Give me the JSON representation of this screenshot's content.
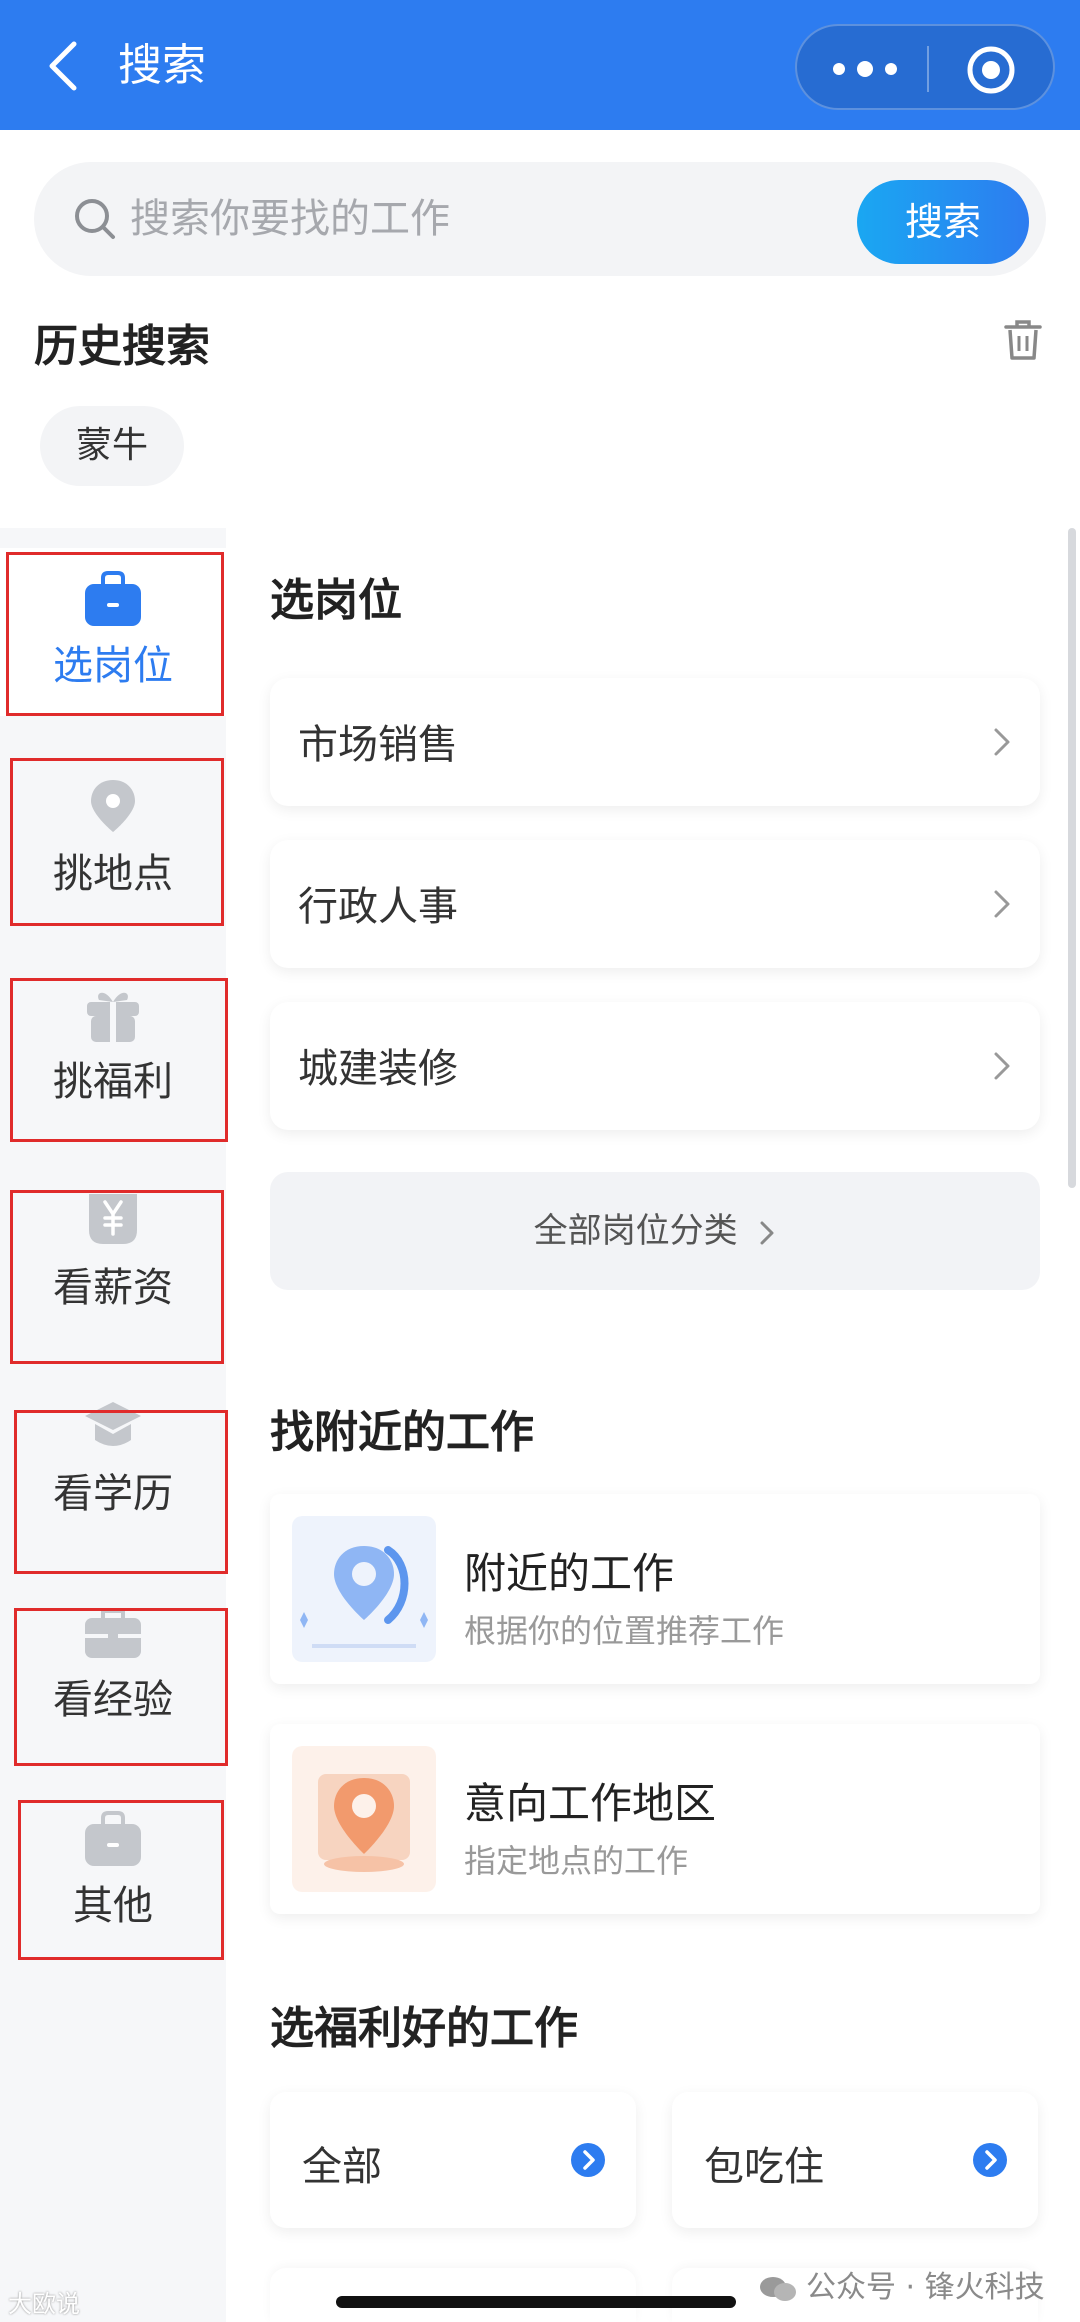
{
  "navbar": {
    "title": "搜索"
  },
  "search": {
    "placeholder": "搜索你要找的工作",
    "button_label": "搜索"
  },
  "history": {
    "title": "历史搜索",
    "items": [
      "蒙牛"
    ]
  },
  "sidebar": {
    "items": [
      {
        "label": "选岗位",
        "icon": "briefcase-icon",
        "active": true
      },
      {
        "label": "挑地点",
        "icon": "location-pin-icon"
      },
      {
        "label": "挑福利",
        "icon": "gift-icon"
      },
      {
        "label": "看薪资",
        "icon": "yuan-icon"
      },
      {
        "label": "看学历",
        "icon": "graduation-cap-icon"
      },
      {
        "label": "看经验",
        "icon": "toolbox-icon"
      },
      {
        "label": "其他",
        "icon": "bag-icon"
      }
    ]
  },
  "positions": {
    "title": "选岗位",
    "categories": [
      "市场销售",
      "行政人事",
      "城建装修"
    ],
    "all_label": "全部岗位分类"
  },
  "nearby": {
    "title": "找附近的工作",
    "cards": [
      {
        "title": "附近的工作",
        "subtitle": "根据你的位置推荐工作"
      },
      {
        "title": "意向工作地区",
        "subtitle": "指定地点的工作"
      }
    ]
  },
  "welfare": {
    "title": "选福利好的工作",
    "options": [
      "全部",
      "包吃住"
    ]
  },
  "watermarks": {
    "left": "大欧说",
    "right": "公众号 · 锋火科技"
  },
  "colors": {
    "brand": "#2d7cf0",
    "highlight_box": "#e02b2b"
  }
}
